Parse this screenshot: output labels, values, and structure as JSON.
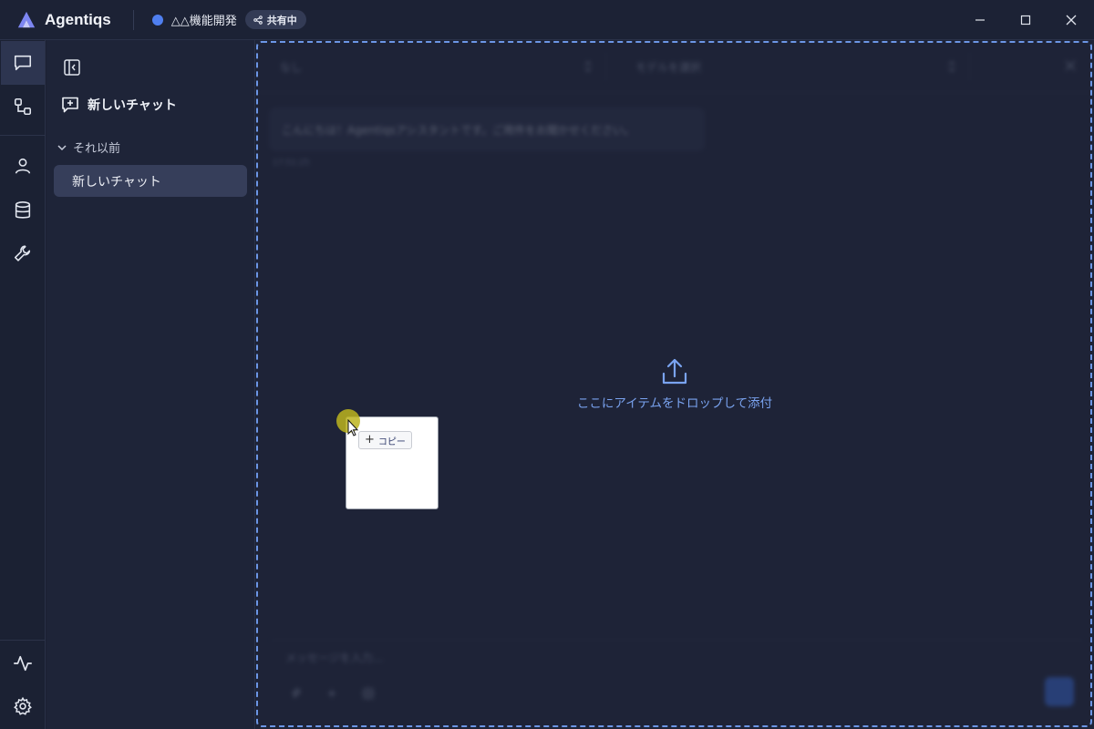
{
  "app": {
    "name": "Agentiqs",
    "logo_icon": "agentiqs-logo-icon"
  },
  "workspace": {
    "name": "△△機能開発",
    "dot_color": "#4f7ff0",
    "share_label": "共有中",
    "share_icon": "share-icon"
  },
  "window_controls": [
    "minimize-icon",
    "maximize-icon",
    "close-icon"
  ],
  "rail": {
    "top": [
      "chat-bubble-icon",
      "workflow-icon"
    ],
    "middle": [
      "user-icon",
      "database-icon",
      "wrench-icon"
    ],
    "bottom": [
      "activity-icon",
      "gear-icon"
    ],
    "active": "chat-bubble-icon"
  },
  "sidebar": {
    "new_chat_label": "新しいチャット",
    "section_label": "それ以前",
    "items": [
      {
        "label": "新しいチャット",
        "selected": true
      }
    ]
  },
  "main": {
    "agent_select_value": "なし",
    "model_select_placeholder": "モデルを選択",
    "greeting": "こんにちは！Agentiqsアシスタントです。ご用件をお聞かせください。",
    "greeting_time": "17:51:25",
    "input_placeholder": "メッセージを入力..."
  },
  "drop_overlay": {
    "text": "ここにアイテムをドロップして添付",
    "icon": "upload-icon",
    "accent": "#6c96e6"
  },
  "drag_tooltip": {
    "label": "コピー"
  },
  "colors": {
    "accent": "#3b72e8",
    "background": "#1e2438",
    "rail": "#1b2133",
    "selected": "#363e5a"
  }
}
